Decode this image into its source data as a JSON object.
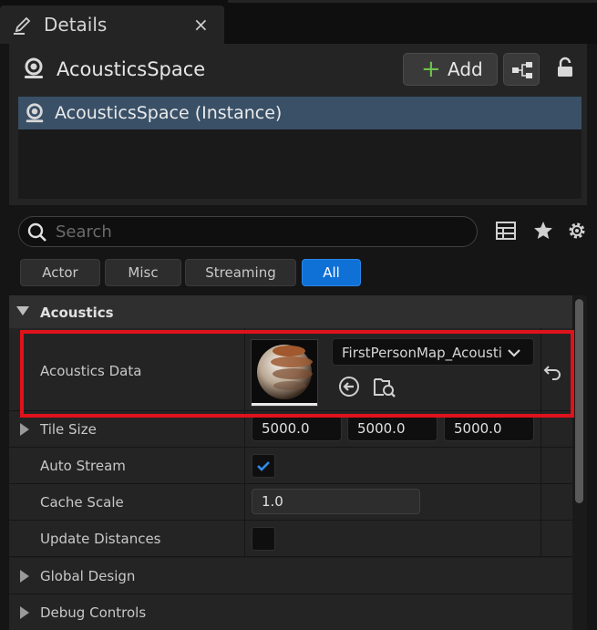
{
  "tab": {
    "title": "Details",
    "close": "×"
  },
  "header": {
    "actor_name": "AcousticsSpace",
    "add_label": "Add",
    "add_plus": "+",
    "instance_label": "AcousticsSpace (Instance)"
  },
  "search": {
    "placeholder": "Search"
  },
  "filters": [
    "Actor",
    "Misc",
    "Streaming",
    "All"
  ],
  "active_filter": "All",
  "category": {
    "acoustics": "Acoustics"
  },
  "properties": {
    "acoustics_data": {
      "label": "Acoustics Data",
      "value": "FirstPersonMap_Acoustics"
    },
    "tile_size": {
      "label": "Tile Size",
      "x": "5000.0",
      "y": "5000.0",
      "z": "5000.0"
    },
    "auto_stream": {
      "label": "Auto Stream",
      "checked": true
    },
    "cache_scale": {
      "label": "Cache Scale",
      "value": "1.0"
    },
    "update_distances": {
      "label": "Update Distances",
      "checked": false
    },
    "global_design": {
      "label": "Global Design"
    },
    "debug_controls": {
      "label": "Debug Controls"
    }
  },
  "colors": {
    "accent": "#0f70d6",
    "highlight_box": "#e0121b",
    "add_green": "#6cc24a",
    "selection": "#395067"
  },
  "icons": [
    "pencil-icon",
    "close-icon",
    "acoustics-icon",
    "plus-icon",
    "blueprint-icon",
    "lock-icon",
    "search-icon",
    "table-view-icon",
    "star-icon",
    "gear-icon",
    "chevron-down-icon",
    "use-selected-icon",
    "browse-icon",
    "reset-icon",
    "checkmark-icon"
  ]
}
